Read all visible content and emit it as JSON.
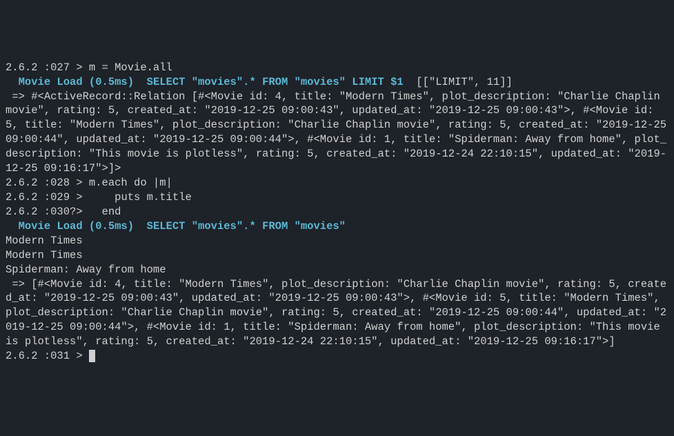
{
  "lines": {
    "l1_prefix": "2.6.2 :027 > ",
    "l1_cmd": "m = Movie.all",
    "l2_load": "  Movie Load (0.5ms)  ",
    "l2_sql": "SELECT \"movies\".* FROM \"movies\" LIMIT $1",
    "l2_tail": "  [[\"LIMIT\", 11]]",
    "l3": " => #<ActiveRecord::Relation [#<Movie id: 4, title: \"Modern Times\", plot_description: \"Charlie Chaplin movie\", rating: 5, created_at: \"2019-12-25 09:00:43\", updated_at: \"2019-12-25 09:00:43\">, #<Movie id: 5, title: \"Modern Times\", plot_description: \"Charlie Chaplin movie\", rating: 5, created_at: \"2019-12-25 09:00:44\", updated_at: \"2019-12-25 09:00:44\">, #<Movie id: 1, title: \"Spiderman: Away from home\", plot_description: \"This movie is plotless\", rating: 5, created_at: \"2019-12-24 22:10:15\", updated_at: \"2019-12-25 09:16:17\">]>",
    "l4_prefix": "2.6.2 :028 > ",
    "l4_cmd": "m.each do |m|",
    "l5_prefix": "2.6.2 :029 >     ",
    "l5_cmd": "puts m.title",
    "l6_prefix": "2.6.2 :030?>   ",
    "l6_cmd": "end",
    "l7_load": "  Movie Load (0.5ms)  ",
    "l7_sql": "SELECT \"movies\".* FROM \"movies\"",
    "l8": "Modern Times",
    "l9": "Modern Times",
    "l10": "Spiderman: Away from home",
    "l11": " => [#<Movie id: 4, title: \"Modern Times\", plot_description: \"Charlie Chaplin movie\", rating: 5, created_at: \"2019-12-25 09:00:43\", updated_at: \"2019-12-25 09:00:43\">, #<Movie id: 5, title: \"Modern Times\", plot_description: \"Charlie Chaplin movie\", rating: 5, created_at: \"2019-12-25 09:00:44\", updated_at: \"2019-12-25 09:00:44\">, #<Movie id: 1, title: \"Spiderman: Away from home\", plot_description: \"This movie is plotless\", rating: 5, created_at: \"2019-12-24 22:10:15\", updated_at: \"2019-12-25 09:16:17\">]",
    "l12_prefix": "2.6.2 :031 > "
  }
}
